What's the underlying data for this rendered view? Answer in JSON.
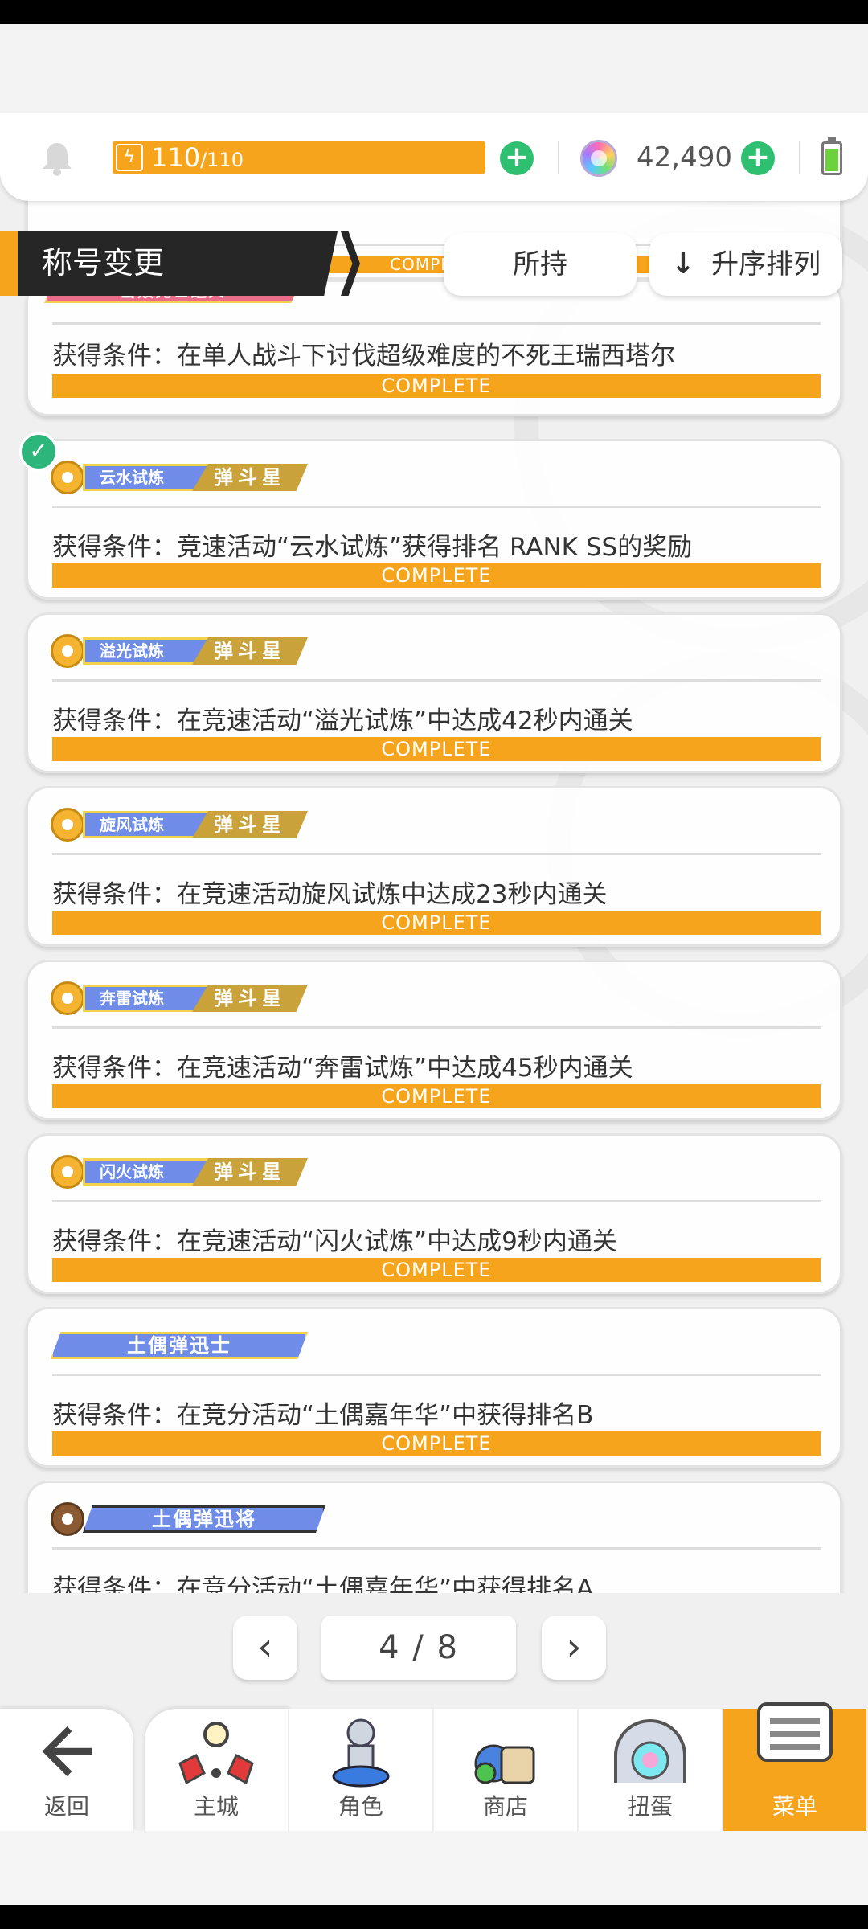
{
  "resources": {
    "stamina_current": "110",
    "stamina_max": "/110",
    "gems": "42,490"
  },
  "header": {
    "title": "称号变更",
    "owned_label": "所持",
    "sort_label": "升序排列"
  },
  "list": {
    "partial_top": {
      "badge": "击败死亡之人",
      "status": "COMPLETE"
    },
    "items": [
      {
        "badge": "",
        "condition": "获得条件：在单人战斗下讨伐超级难度的不死王瑞西塔尔",
        "status": "COMPLETE"
      },
      {
        "badge": "云水试炼",
        "rank": "弹斗星",
        "condition": "获得条件：竞速活动“云水试炼”获得排名 RANK SS的奖励",
        "status": "COMPLETE"
      },
      {
        "badge": "溢光试炼",
        "rank": "弹斗星",
        "condition": "获得条件：在竞速活动“溢光试炼”中达成42秒内通关",
        "status": "COMPLETE"
      },
      {
        "badge": "旋风试炼",
        "rank": "弹斗星",
        "condition": "获得条件：在竞速活动旋风试炼中达成23秒内通关",
        "status": "COMPLETE"
      },
      {
        "badge": "奔雷试炼",
        "rank": "弹斗星",
        "condition": "获得条件：在竞速活动“奔雷试炼”中达成45秒内通关",
        "status": "COMPLETE"
      },
      {
        "badge": "闪火试炼",
        "rank": "弹斗星",
        "condition": "获得条件：在竞速活动“闪火试炼”中达成9秒内通关",
        "status": "COMPLETE"
      },
      {
        "badge": "土偶弹迅士",
        "condition": "获得条件：在竞分活动“土偶嘉年华”中获得排名B",
        "status": "COMPLETE"
      },
      {
        "badge": "土偶弹迅将",
        "condition": "获得条件：在竞分活动“土偶嘉年华”中获得排名A"
      }
    ]
  },
  "pager": {
    "label": "4 / 8"
  },
  "nav": {
    "back": "返回",
    "items": [
      "主城",
      "角色",
      "商店",
      "扭蛋",
      "菜单"
    ]
  },
  "colors": {
    "accent": "#f7a41d",
    "confirm": "#2fbf71",
    "badge_blue": "#6f8de8"
  }
}
